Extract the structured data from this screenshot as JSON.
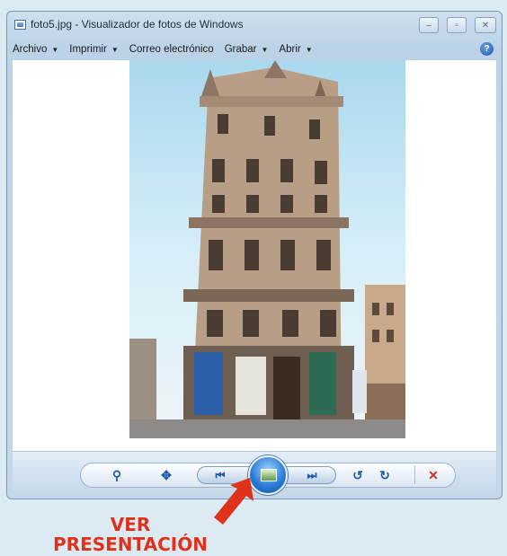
{
  "window": {
    "title": "foto5.jpg - Visualizador de fotos de Windows",
    "controls": [
      "–",
      "▫",
      "✕"
    ]
  },
  "menu": {
    "items": [
      {
        "label": "Archivo",
        "has_arrow": true
      },
      {
        "label": "Imprimir",
        "has_arrow": true
      },
      {
        "label": "Correo electrónico",
        "has_arrow": false
      },
      {
        "label": "Grabar",
        "has_arrow": true
      },
      {
        "label": "Abrir",
        "has_arrow": true
      }
    ],
    "help": "?"
  },
  "controls": {
    "zoom": "⚲",
    "fit": "✥",
    "prev": "⏮",
    "next": "⏭",
    "rotate_left": "↺",
    "rotate_right": "↻",
    "delete": "✕"
  },
  "annotation": {
    "line1": "VER",
    "line2": "PRESENTACIÓN",
    "color": "#e0311a"
  },
  "icons": [
    "photo-viewer-icon",
    "minimize-icon",
    "maximize-icon",
    "close-icon",
    "help-icon",
    "zoom-icon",
    "fit-window-icon",
    "previous-icon",
    "slideshow-icon",
    "next-icon",
    "rotate-left-icon",
    "rotate-right-icon",
    "delete-icon",
    "arrow-icon"
  ]
}
